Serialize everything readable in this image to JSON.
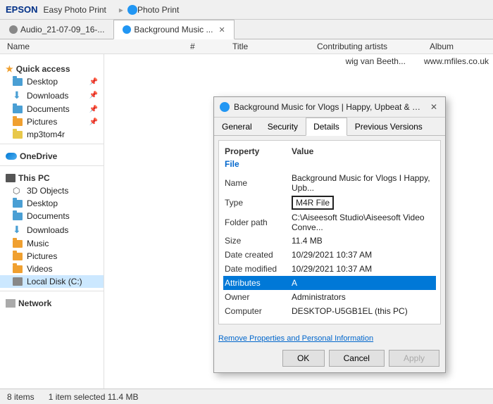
{
  "topbar": {
    "brand": "EPSON",
    "app": "Easy Photo Print",
    "separator": "▸",
    "photo_print": "Photo Print"
  },
  "tabs": [
    {
      "id": "audio",
      "label": "Audio_21-07-09_16-...",
      "active": false
    },
    {
      "id": "background",
      "label": "Background Music ...",
      "active": true
    }
  ],
  "columns": {
    "name": "Name",
    "hash": "#",
    "title": "Title",
    "contrib": "Contributing artists",
    "album": "Album"
  },
  "sidebar": {
    "quick_access": "Quick access",
    "items_quick": [
      {
        "label": "Desktop",
        "pinned": true
      },
      {
        "label": "Downloads",
        "pinned": true
      },
      {
        "label": "Documents",
        "pinned": true
      },
      {
        "label": "Pictures",
        "pinned": true
      },
      {
        "label": "mp3tom4r",
        "pinned": false
      }
    ],
    "onedrive": "OneDrive",
    "this_pc": "This PC",
    "items_pc": [
      {
        "label": "3D Objects"
      },
      {
        "label": "Desktop"
      },
      {
        "label": "Documents"
      },
      {
        "label": "Downloads"
      },
      {
        "label": "Music"
      },
      {
        "label": "Pictures"
      },
      {
        "label": "Videos"
      },
      {
        "label": "Local Disk (C:)",
        "selected": true
      }
    ],
    "network": "Network"
  },
  "file_list": {
    "row1": "wig van Beeth...",
    "row1_col2": "www.mfiles.co.uk"
  },
  "dialog": {
    "title": "Background Music for Vlogs | Happy, Upbeat & Perfect...",
    "tabs": [
      "General",
      "Security",
      "Details",
      "Previous Versions"
    ],
    "active_tab": "Details",
    "prop_header1": "Property",
    "prop_header2": "Value",
    "section": "File",
    "rows": [
      {
        "label": "Name",
        "value": "Background Music for Vlogs I Happy, Upb...",
        "highlighted": false
      },
      {
        "label": "Type",
        "value": "M4R File",
        "highlighted": false,
        "boxed": true
      },
      {
        "label": "Folder path",
        "value": "C:\\Aiseesoft Studio\\Aiseesoft Video Conve...",
        "highlighted": false
      },
      {
        "label": "Size",
        "value": "11.4 MB",
        "highlighted": false
      },
      {
        "label": "Date created",
        "value": "10/29/2021 10:37 AM",
        "highlighted": false
      },
      {
        "label": "Date modified",
        "value": "10/29/2021 10:37 AM",
        "highlighted": false
      },
      {
        "label": "Attributes",
        "value": "A",
        "highlighted": true
      },
      {
        "label": "Owner",
        "value": "Administrators",
        "highlighted": false
      },
      {
        "label": "Computer",
        "value": "DESKTOP-U5GB1EL (this PC)",
        "highlighted": false
      }
    ],
    "footer_link": "Remove Properties and Personal Information",
    "buttons": {
      "ok": "OK",
      "cancel": "Cancel",
      "apply": "Apply"
    }
  },
  "statusbar": {
    "items": "8 items",
    "selected": "1 item selected  11.4 MB"
  }
}
